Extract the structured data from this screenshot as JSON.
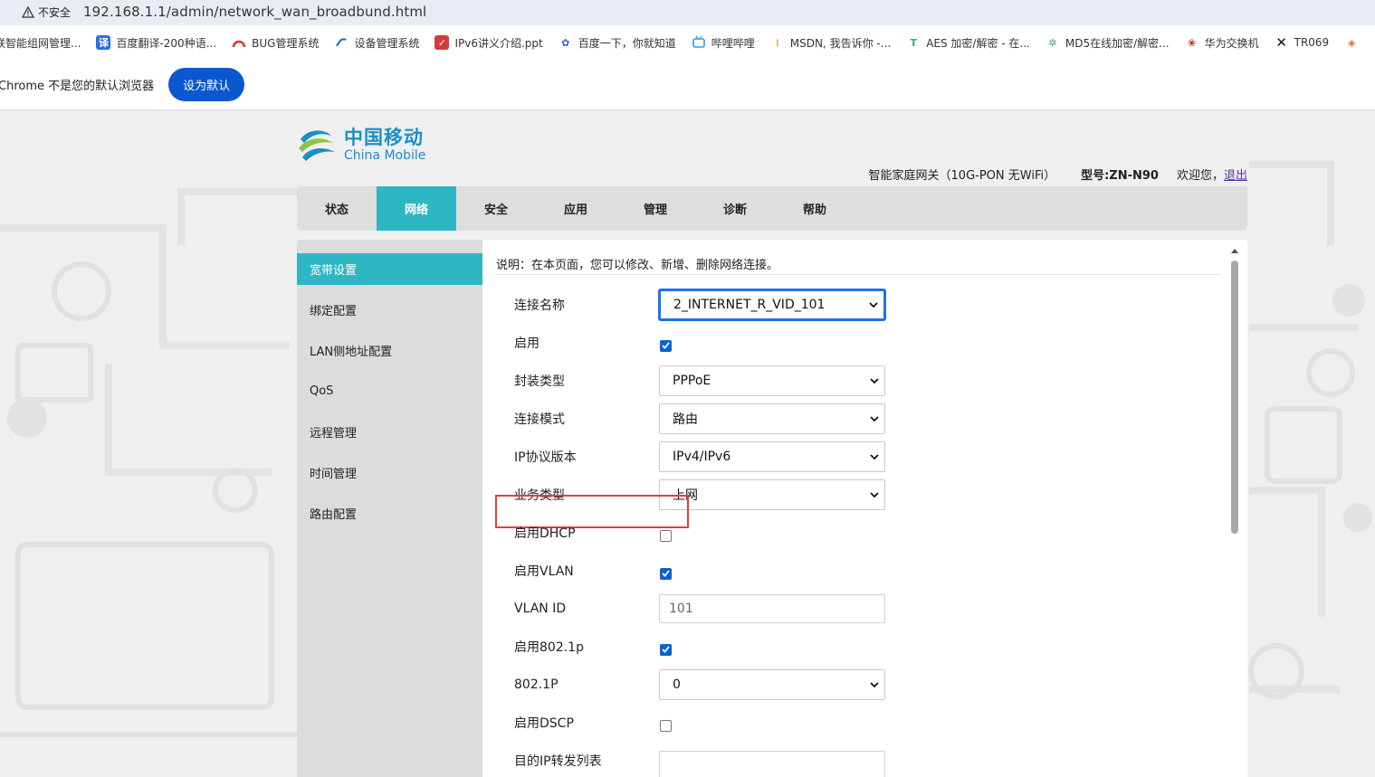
{
  "browser": {
    "security_label": "不安全",
    "url": "192.168.1.1/admin/network_wan_broadbund.html",
    "bookmarks": [
      {
        "label": "联智能组网管理...",
        "icon": "folder-icon"
      },
      {
        "label": "百度翻译-200种语...",
        "icon": "baidu-translate-icon"
      },
      {
        "label": "BUG管理系统",
        "icon": "bug-icon"
      },
      {
        "label": "设备管理系统",
        "icon": "device-icon"
      },
      {
        "label": "IPv6讲义介绍.ppt",
        "icon": "ppt-icon"
      },
      {
        "label": "百度一下，你就知道",
        "icon": "baidu-icon"
      },
      {
        "label": "哔哩哔哩",
        "icon": "bilibili-icon"
      },
      {
        "label": "MSDN, 我告诉你 -...",
        "icon": "msdn-icon"
      },
      {
        "label": "AES 加密/解密 - 在...",
        "icon": "aes-icon"
      },
      {
        "label": "MD5在线加密/解密...",
        "icon": "md5-icon"
      },
      {
        "label": "华为交换机",
        "icon": "huawei-icon"
      },
      {
        "label": "TR069",
        "icon": "tr069-icon"
      }
    ],
    "infobar_text": "Chrome 不是您的默认浏览器",
    "infobar_button": "设为默认"
  },
  "header": {
    "logo_cn": "中国移动",
    "logo_en": "China Mobile",
    "device_name": "智能家庭网关（10G-PON 无WiFi）",
    "model": "型号:ZN-N90",
    "welcome": "欢迎您，",
    "logout": "退出"
  },
  "nav": {
    "tabs": [
      "状态",
      "网络",
      "安全",
      "应用",
      "管理",
      "诊断",
      "帮助"
    ],
    "active": "网络"
  },
  "sidebar": {
    "items": [
      "宽带设置",
      "绑定配置",
      "LAN侧地址配置",
      "QoS",
      "远程管理",
      "时间管理",
      "路由配置"
    ],
    "active": "宽带设置"
  },
  "form": {
    "description": "说明：在本页面，您可以修改、新增、删除网络连接。",
    "connection_name": {
      "label": "连接名称",
      "value": "2_INTERNET_R_VID_101"
    },
    "enable": {
      "label": "启用",
      "checked": true
    },
    "encap_type": {
      "label": "封装类型",
      "value": "PPPoE"
    },
    "conn_mode": {
      "label": "连接模式",
      "value": "路由"
    },
    "ip_version": {
      "label": "IP协议版本",
      "value": "IPv4/IPv6"
    },
    "service_type": {
      "label": "业务类型",
      "value": "上网"
    },
    "enable_dhcp": {
      "label": "启用DHCP",
      "checked": false
    },
    "enable_vlan": {
      "label": "启用VLAN",
      "checked": true
    },
    "vlan_id": {
      "label": "VLAN ID",
      "value": "101"
    },
    "enable_8021p": {
      "label": "启用802.1p",
      "checked": true
    },
    "p8021": {
      "label": "802.1P",
      "value": "0"
    },
    "enable_dscp": {
      "label": "启用DSCP",
      "checked": false
    },
    "dest_ip_list": {
      "label": "目的IP转发列表",
      "value": ""
    }
  },
  "colors": {
    "accent": "#2eb7c2",
    "highlight": "#e0403a",
    "chrome_button": "#0b57d0"
  }
}
